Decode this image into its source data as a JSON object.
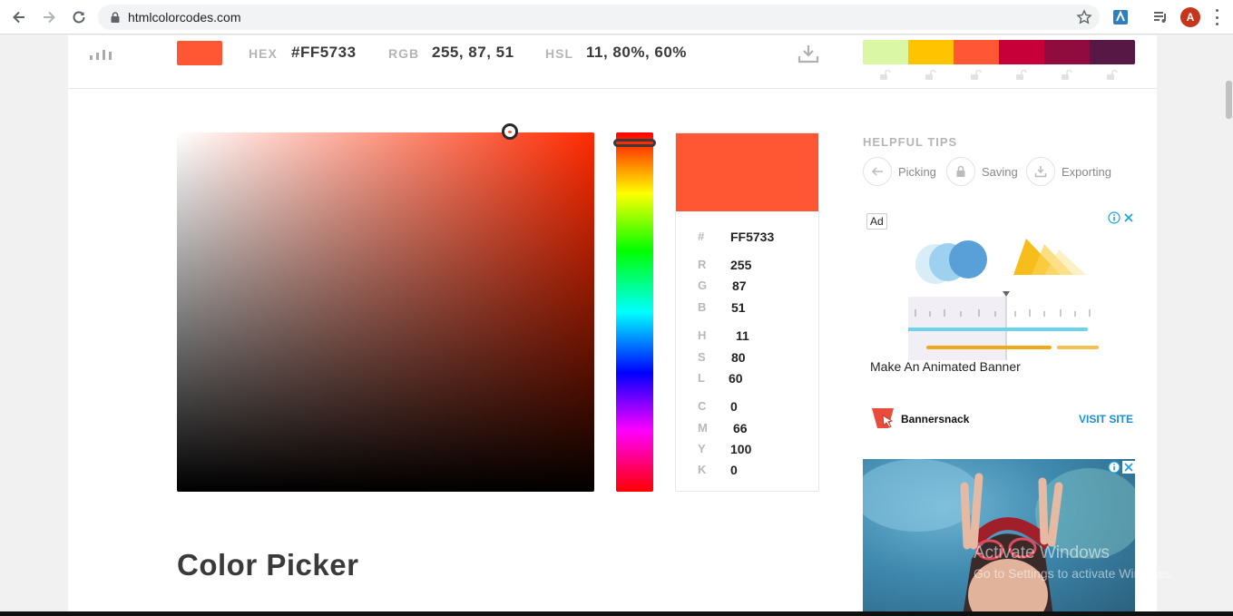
{
  "browser": {
    "url": "htmlcolorcodes.com",
    "avatar_letter": "A"
  },
  "topbar": {
    "current_color": "#FF5733",
    "hex_label": "HEX",
    "hex_value": "#FF5733",
    "rgb_label": "RGB",
    "rgb_value": "255, 87, 51",
    "hsl_label": "HSL",
    "hsl_value": "11, 80%, 60%",
    "palette": [
      "#DAF7A6",
      "#FFC300",
      "#FF5733",
      "#C70039",
      "#900C3F",
      "#581845"
    ]
  },
  "picker": {
    "preview_color": "#FF5733",
    "values": {
      "hex": {
        "key": "#",
        "value": "FF5733"
      },
      "r": {
        "key": "R",
        "value": "255"
      },
      "g": {
        "key": "G",
        "value": "87"
      },
      "b": {
        "key": "B",
        "value": "51"
      },
      "h": {
        "key": "H",
        "value": "11"
      },
      "s": {
        "key": "S",
        "value": "80"
      },
      "l": {
        "key": "L",
        "value": "60"
      },
      "c": {
        "key": "C",
        "value": "0"
      },
      "m": {
        "key": "M",
        "value": "66"
      },
      "y": {
        "key": "Y",
        "value": "100"
      },
      "k": {
        "key": "K",
        "value": "0"
      }
    }
  },
  "page_title": "Color Picker",
  "tips": {
    "title": "HELPFUL TIPS",
    "items": [
      "Picking",
      "Saving",
      "Exporting"
    ]
  },
  "ad1": {
    "badge": "Ad",
    "caption": "Make An Animated Banner",
    "brand": "Bannersnack",
    "visit": "VISIT SITE"
  },
  "watermark": {
    "line1": "Activate Windows",
    "line2": "Go to Settings to activate Windows."
  }
}
